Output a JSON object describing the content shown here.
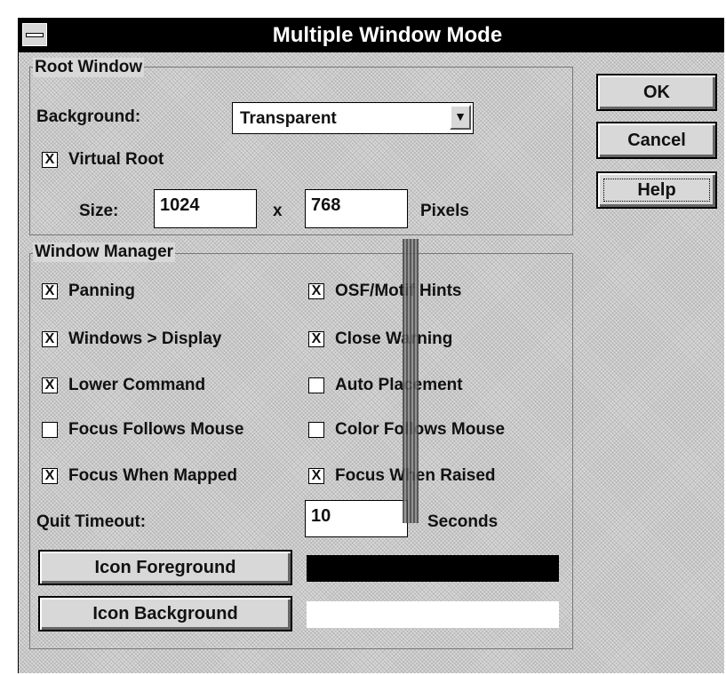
{
  "window": {
    "title": "Multiple Window Mode"
  },
  "buttons": {
    "ok": "OK",
    "cancel": "Cancel",
    "help": "Help"
  },
  "root_window": {
    "title": "Root Window",
    "background_label": "Background:",
    "background_value": "Transparent",
    "virtual_root_label": "Virtual Root",
    "virtual_root_checked": true,
    "size_label": "Size:",
    "width": "1024",
    "x_sep": "x",
    "height": "768",
    "units": "Pixels"
  },
  "window_manager": {
    "title": "Window Manager",
    "options": [
      {
        "label": "Panning",
        "checked": true
      },
      {
        "label": "OSF/Motif Hints",
        "checked": true
      },
      {
        "label": "Windows > Display",
        "checked": true
      },
      {
        "label": "Close Warning",
        "checked": true
      },
      {
        "label": "Lower Command",
        "checked": true
      },
      {
        "label": "Auto Placement",
        "checked": false
      },
      {
        "label": "Focus Follows Mouse",
        "checked": false
      },
      {
        "label": "Color Follows Mouse",
        "checked": false
      },
      {
        "label": "Focus When Mapped",
        "checked": true
      },
      {
        "label": "Focus When Raised",
        "checked": true
      }
    ],
    "quit_timeout_label": "Quit Timeout:",
    "quit_timeout_value": "10",
    "quit_timeout_units": "Seconds",
    "icon_foreground_label": "Icon Foreground",
    "icon_foreground_color": "#000000",
    "icon_background_label": "Icon Background",
    "icon_background_color": "#ffffff"
  },
  "check_glyph": "X"
}
